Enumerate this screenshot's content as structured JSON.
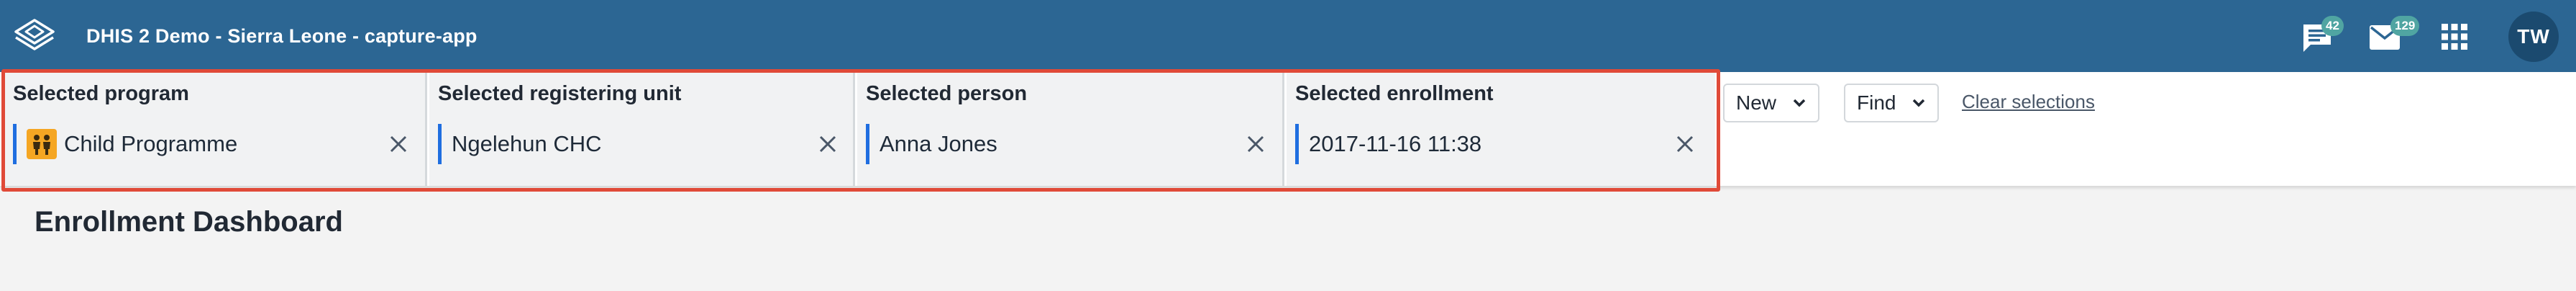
{
  "header": {
    "app_title": "DHIS 2 Demo - Sierra Leone - capture-app",
    "logo_icon": "dhis2-logo-icon",
    "interpretations_count": "42",
    "messages_count": "129",
    "apps_icon": "apps-grid-icon",
    "user_initials": "TW",
    "color": "#2c6693"
  },
  "selections": {
    "program": {
      "label": "Selected program",
      "value": "Child Programme",
      "icon": "child-programme-icon"
    },
    "org_unit": {
      "label": "Selected registering unit",
      "value": "Ngelehun CHC"
    },
    "person": {
      "label": "Selected person",
      "value": "Anna Jones"
    },
    "enrollment": {
      "label": "Selected enrollment",
      "value": "2017-11-16 11:38"
    },
    "highlight_color": "#e04a38",
    "accent_color": "#1f6ee0"
  },
  "actions": {
    "new_label": "New",
    "find_label": "Find",
    "clear_selections_label": "Clear selections"
  },
  "page": {
    "title": "Enrollment Dashboard"
  }
}
